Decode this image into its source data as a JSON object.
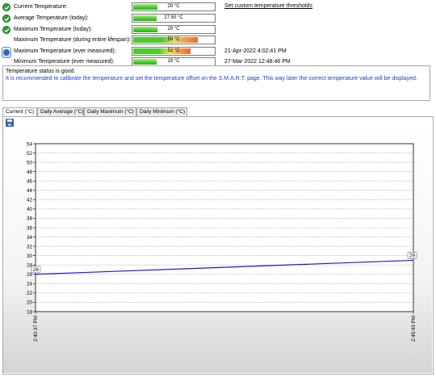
{
  "summary": {
    "rows": [
      {
        "icon": "check-icon",
        "label": "Current Temperature:",
        "value": "29 °C",
        "fill": 0.29,
        "style": "green",
        "date": ""
      },
      {
        "icon": "check-icon",
        "label": "Average Temperature (today):",
        "value": "27.50 °C",
        "fill": 0.275,
        "style": "green",
        "date": ""
      },
      {
        "icon": "check-icon",
        "label": "Maximum Temperature (today):",
        "value": "29 °C",
        "fill": 0.29,
        "style": "green",
        "date": ""
      },
      {
        "icon": "",
        "label": "Maximum Temperature (during entire lifespan):",
        "value": "59 °C",
        "fill": 0.78,
        "style": "orange",
        "date": ""
      },
      {
        "icon": "",
        "label": "Maximum Temperature (ever measured):",
        "value": "52 °C",
        "fill": 0.7,
        "style": "orange",
        "date": "21-Apr-2022 4:02:41 PM"
      },
      {
        "icon": "",
        "label": "Minimum Temperature (ever measured):",
        "value": "19 °C",
        "fill": 0.28,
        "style": "green",
        "date": "27-Mar-2022 12:48:46 PM"
      }
    ],
    "custom_thresholds_link": "Set custom temperature thresholds"
  },
  "status": {
    "line1": "Temperature status is good.",
    "line2": "It is recommended to calibrate the temperature and set the temperature offset on the S.M.A.R.T. page. This way later the correct temperature value will be displayed."
  },
  "tabs": [
    "Current (°C)",
    "Daily Average (°C)",
    "Daily Maximum (°C)",
    "Daily Minimum (°C)"
  ],
  "colors": {
    "line": "#1a1acc",
    "check": "#2f9e3a",
    "status_text": "#1f3ad6"
  },
  "chart_data": {
    "type": "line",
    "title": "",
    "xlabel": "",
    "ylabel": "",
    "ylim": [
      18,
      54
    ],
    "yticks": [
      18,
      20,
      22,
      24,
      26,
      28,
      30,
      32,
      34,
      36,
      38,
      40,
      42,
      44,
      46,
      48,
      50,
      52,
      54
    ],
    "xticks": [
      "2:40:37 PM",
      "2:45:43 PM"
    ],
    "series": [
      {
        "x": [
          "2:40:37 PM",
          "2:45:43 PM"
        ],
        "values": [
          26,
          29
        ]
      }
    ],
    "point_labels": [
      "26",
      "29"
    ],
    "grid": true
  }
}
